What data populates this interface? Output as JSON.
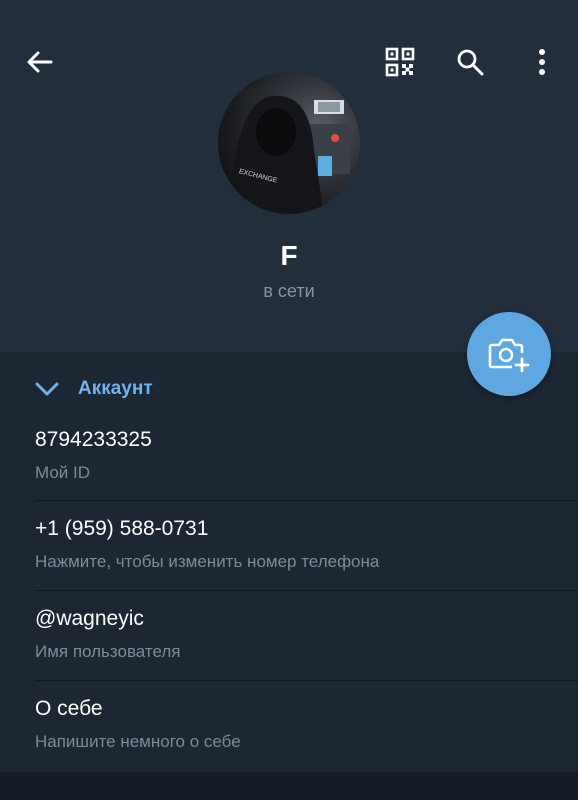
{
  "profile": {
    "name": "F",
    "status": "в сети"
  },
  "account": {
    "section_title": "Аккаунт",
    "rows": [
      {
        "value": "8794233325",
        "label": "Мой ID"
      },
      {
        "value": "+1 (959) 588-0731",
        "label": "Нажмите, чтобы изменить номер телефона"
      },
      {
        "value": "@wagneyic",
        "label": "Имя пользователя"
      },
      {
        "value": "О себе",
        "label": "Напишите немного о себе"
      }
    ]
  },
  "icons": {
    "back": "arrow-left-icon",
    "qr": "qr-code-icon",
    "search": "search-icon",
    "more": "more-vertical-icon",
    "camera": "camera-add-icon",
    "chevron": "chevron-down-icon"
  },
  "colors": {
    "background": "#1c2733",
    "header": "#232e3c",
    "accent": "#6eb3f0",
    "fab": "#5ea7e0",
    "secondary_text": "#7d8b99"
  }
}
